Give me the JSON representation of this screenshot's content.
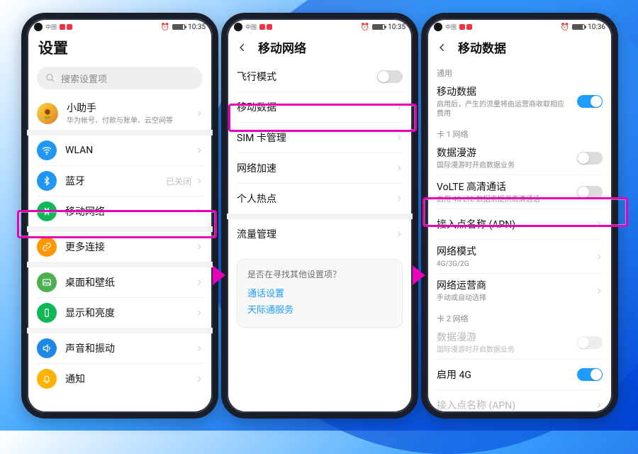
{
  "status": {
    "time": "10:35",
    "time3": "10:36",
    "carrier_cn": "中国"
  },
  "screen1": {
    "title": "设置",
    "search_placeholder": "搜索设置项",
    "profile": {
      "name": "小助手",
      "desc": "华为帐号、付款与账单、云空间等"
    },
    "items": {
      "wlan": "WLAN",
      "bt": "蓝牙",
      "bt_status": "已关闭",
      "mobile": "移动网络",
      "more": "更多连接",
      "wallpaper": "桌面和壁纸",
      "display": "显示和亮度",
      "sound": "声音和振动",
      "notif": "通知"
    }
  },
  "screen2": {
    "title": "移动网络",
    "items": {
      "airplane": "飞行模式",
      "mobiledata": "移动数据",
      "sim": "SIM 卡管理",
      "accel": "网络加速",
      "hotspot": "个人热点",
      "traffic": "流量管理"
    },
    "tip": {
      "q": "是否在寻找其他设置项？",
      "a1": "通话设置",
      "a2": "天际通服务"
    }
  },
  "screen3": {
    "title": "移动数据",
    "sections": {
      "general": "通用",
      "card1": "卡 1 网络",
      "card2": "卡 2 网络"
    },
    "items": {
      "mobiledata": "移动数据",
      "mobiledata_sub": "启用后，产生的流量将由运营商收取相应费用",
      "roaming": "数据漫游",
      "roaming_sub": "国际漫游时开启数据业务",
      "volte": "VoLTE 高清通话",
      "volte_sub": "启用 4G LTE 数据来提供高清通话",
      "apn": "接入点名称 (APN)",
      "mode": "网络模式",
      "mode_sub": "4G/3G/2G",
      "carrier": "网络运营商",
      "carrier_sub": "手动或自动选择",
      "roaming2": "数据漫游",
      "roaming2_sub": "国际漫游时开启数据业务",
      "lte4g": "启用 4G",
      "apn2": "接入点名称 (APN)"
    }
  }
}
